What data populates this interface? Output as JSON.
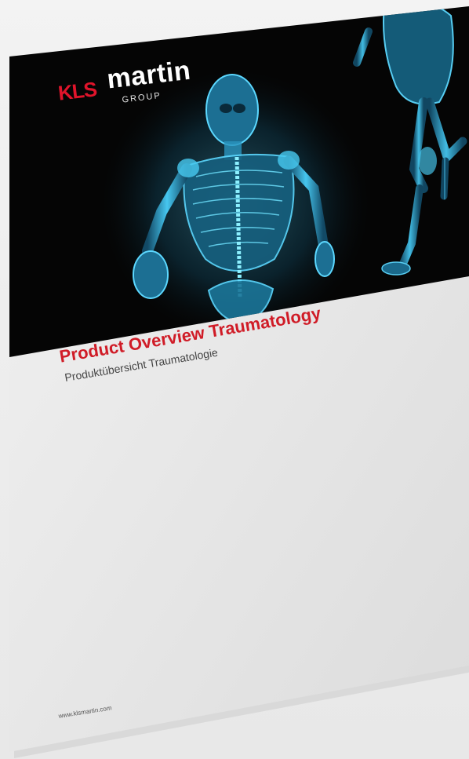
{
  "cover": {
    "logo": {
      "brand_red": "KLS",
      "brand_white": "martin",
      "group": "GROUP"
    },
    "image": {
      "subject": "x-ray skeleton runners",
      "icon": "skeleton-illustration"
    },
    "title": "Product Overview Traumatology",
    "subtitle": "Produktübersicht Traumatologie",
    "url": "www.klsmartin.com"
  },
  "colors": {
    "title_red": "#d01c27",
    "logo_red": "#e0142b",
    "header_black": "#050505",
    "xray_cyan": "#37c6ee"
  }
}
